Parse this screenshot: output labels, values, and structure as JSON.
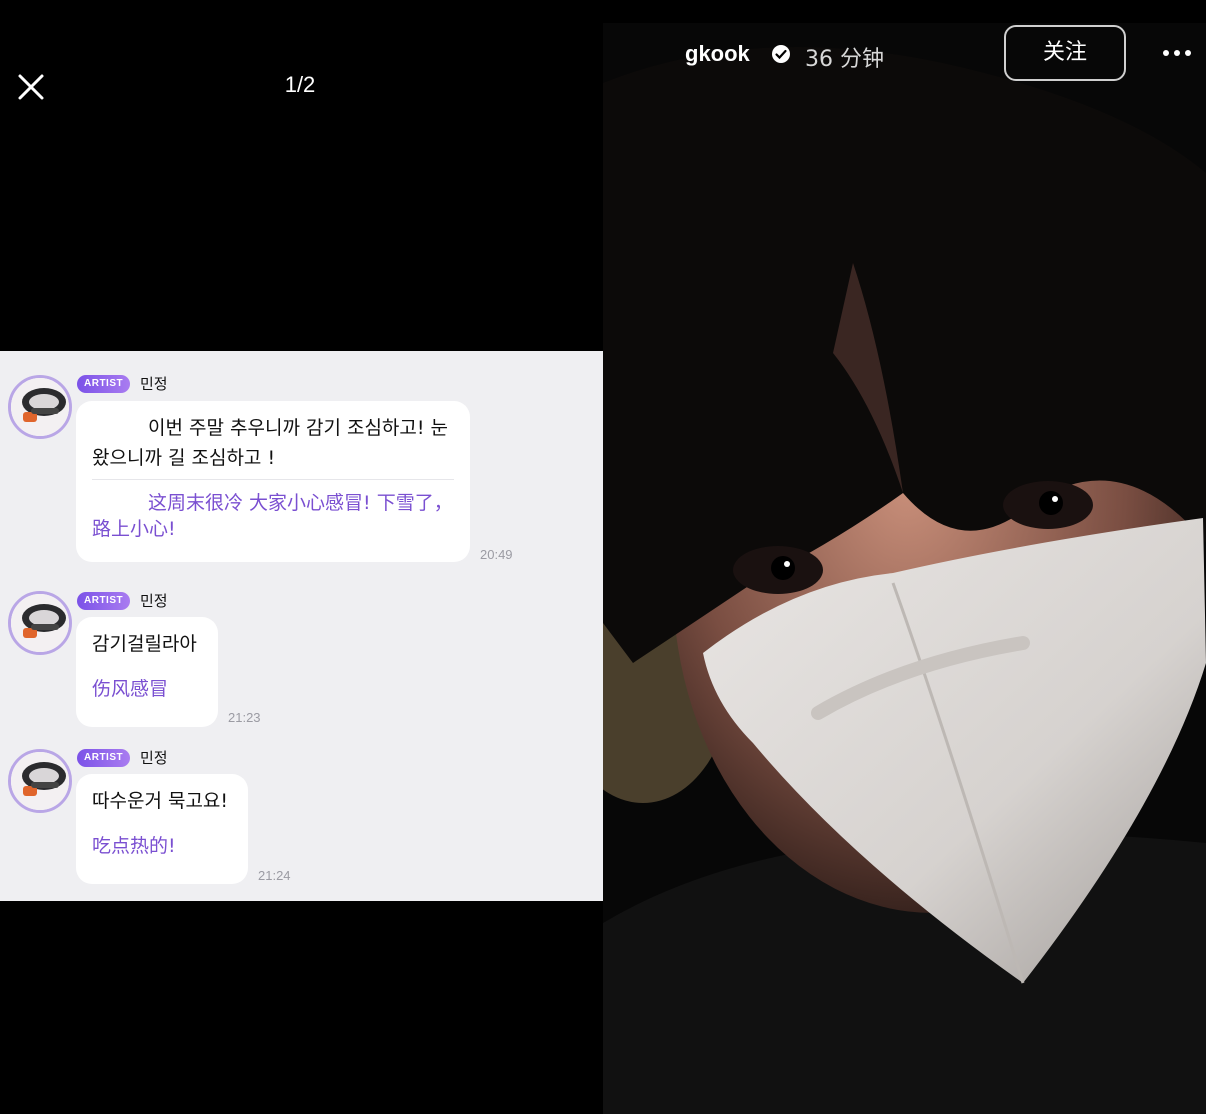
{
  "viewer": {
    "counter": "1/2"
  },
  "chat": {
    "messages": [
      {
        "badge": "ARTIST",
        "sender": "민정",
        "korean": "이번 주말 추우니까 감기 조심하고! 눈 왔으니까 길 조심하고 !",
        "chinese": "这周末很冷 大家小心感冒! 下雪了，路上小心!",
        "time": "20:49"
      },
      {
        "badge": "ARTIST",
        "sender": "민정",
        "korean": "감기걸릴라아",
        "chinese": "伤风感冒",
        "time": "21:23"
      },
      {
        "badge": "ARTIST",
        "sender": "민정",
        "korean": "따수운거 묵고요!",
        "chinese": "吃点热的!",
        "time": "21:24"
      }
    ]
  },
  "post": {
    "username": "gkook",
    "time_ago": "36 分钟",
    "follow_label": "关注",
    "icons": [
      "close-icon",
      "verified-icon",
      "more-icon"
    ],
    "colors": {
      "accent": "#7a4fd1",
      "badge": "#8b5fe9"
    }
  }
}
